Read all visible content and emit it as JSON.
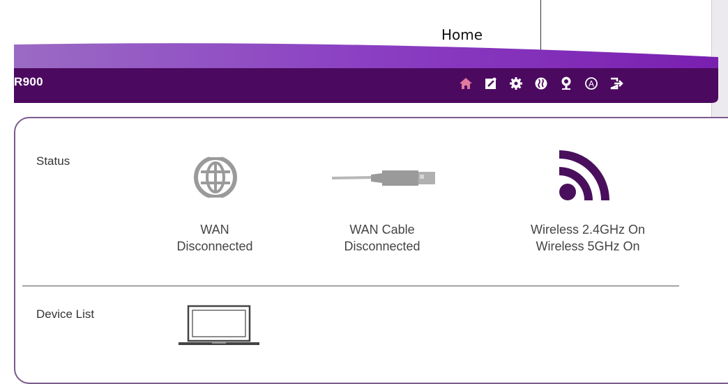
{
  "tooltip": {
    "text": "Home"
  },
  "header": {
    "brand": "R900",
    "toolbar": [
      {
        "name": "home-icon",
        "color": "#e07a9e"
      },
      {
        "name": "setup-wizard-icon",
        "color": "#ffffff"
      },
      {
        "name": "settings-gear-icon",
        "color": "#ffffff"
      },
      {
        "name": "globe-icon",
        "color": "#ffffff"
      },
      {
        "name": "location-pin-icon",
        "color": "#ffffff"
      },
      {
        "name": "advanced-icon",
        "color": "#ffffff"
      },
      {
        "name": "logout-icon",
        "color": "#ffffff"
      }
    ]
  },
  "status": {
    "label": "Status",
    "wan": {
      "line1": "WAN",
      "line2": "Disconnected"
    },
    "wan_cable": {
      "line1": "WAN Cable",
      "line2": "Disconnected"
    },
    "wireless": {
      "line1": "Wireless 2.4GHz On",
      "line2": "Wireless 5GHz On"
    }
  },
  "device_list": {
    "label": "Device List"
  },
  "colors": {
    "brand_purple": "#4b0a5f",
    "accent_purple": "#6f2a8c",
    "wifi_purple": "#4a0f5c"
  }
}
